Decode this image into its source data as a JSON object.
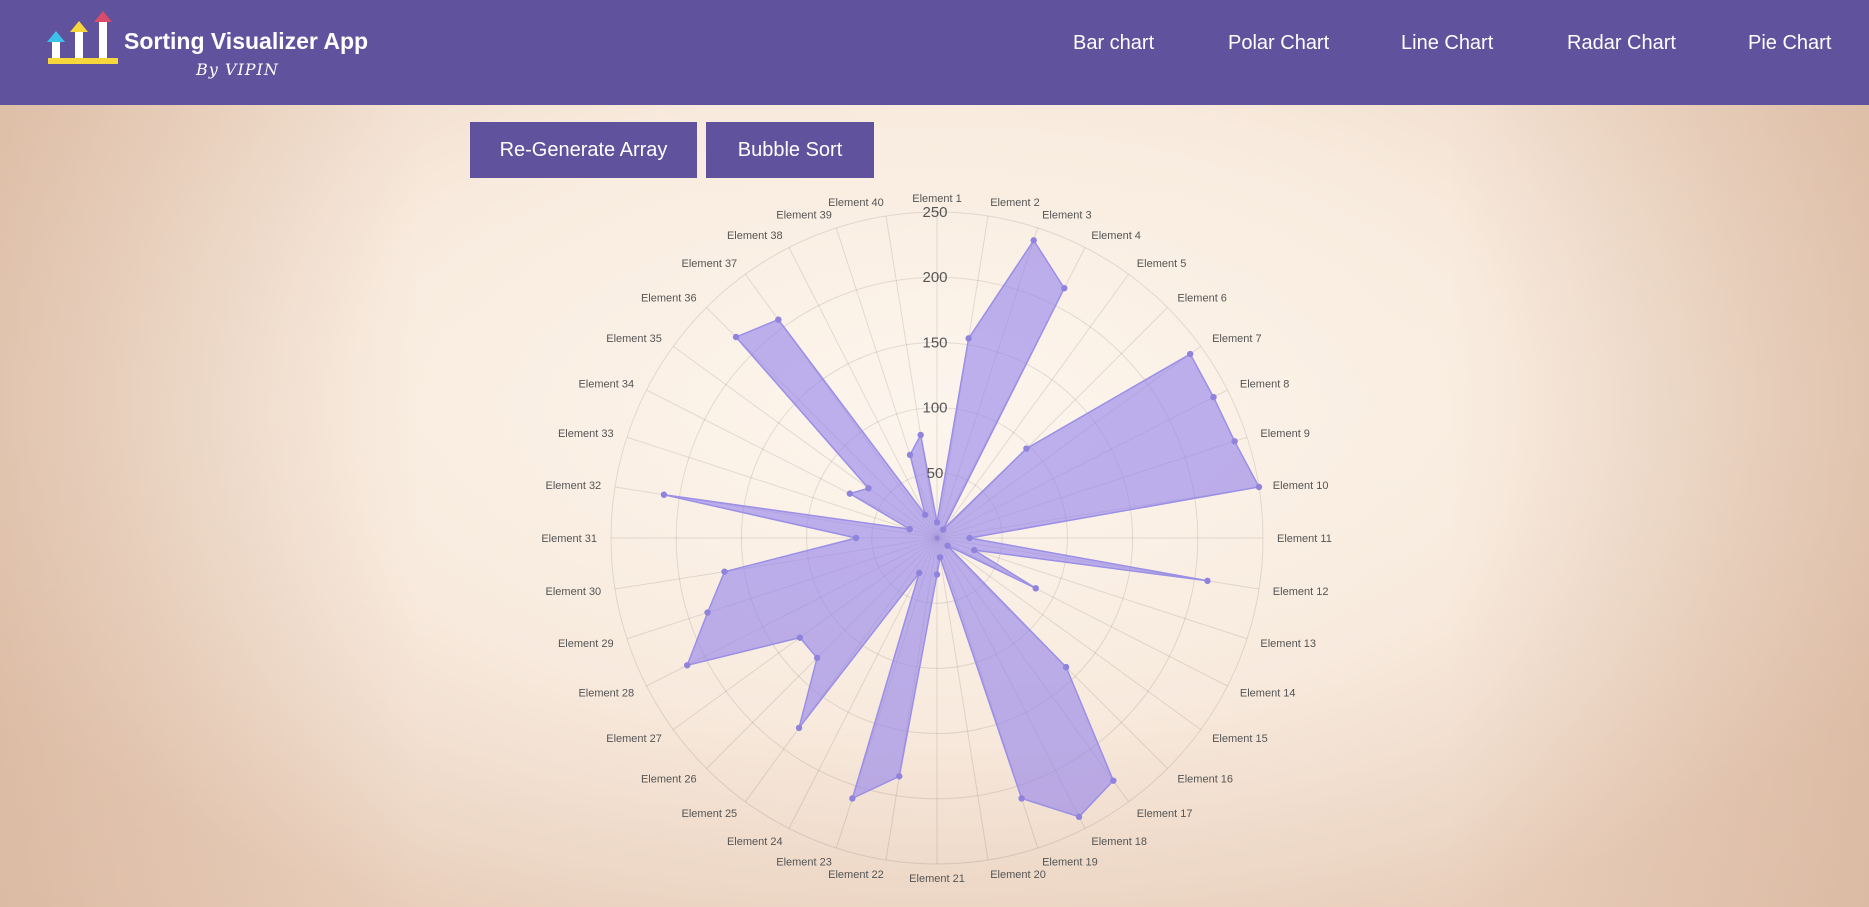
{
  "app": {
    "title": "Sorting Visualizer App",
    "subtitle": "By VIPIN"
  },
  "nav": {
    "items": [
      "Bar chart",
      "Polar Chart",
      "Line Chart",
      "Radar Chart",
      "Pie Chart"
    ]
  },
  "controls": {
    "regenerate_label": "Re-Generate Array",
    "sort_label": "Bubble Sort"
  },
  "colors": {
    "brand": "#61529d",
    "series_fill": "rgba(148,132,236,0.62)",
    "series_stroke": "#9b8fe6",
    "point": "#8f83dc"
  },
  "chart_data": {
    "type": "radar",
    "categories": [
      "Element 1",
      "Element 2",
      "Element 3",
      "Element 4",
      "Element 5",
      "Element 6",
      "Element 7",
      "Element 8",
      "Element 9",
      "Element 10",
      "Element 11",
      "Element 12",
      "Element 13",
      "Element 14",
      "Element 15",
      "Element 16",
      "Element 17",
      "Element 18",
      "Element 19",
      "Element 20",
      "Element 21",
      "Element 22",
      "Element 23",
      "Element 24",
      "Element 25",
      "Element 26",
      "Element 27",
      "Element 28",
      "Element 29",
      "Element 30",
      "Element 31",
      "Element 32",
      "Element 33",
      "Element 34",
      "Element 35",
      "Element 36",
      "Element 37",
      "Element 38",
      "Element 39",
      "Element 40"
    ],
    "values": [
      12,
      155,
      240,
      215,
      8,
      97,
      240,
      238,
      240,
      250,
      25,
      210,
      30,
      85,
      10,
      140,
      230,
      240,
      210,
      15,
      28,
      185,
      210,
      30,
      180,
      130,
      130,
      215,
      185,
      165,
      62,
      212,
      22,
      75,
      65,
      218,
      207,
      20,
      67,
      80
    ],
    "r_ticks": [
      50,
      100,
      150,
      200,
      250
    ],
    "r_range": [
      0,
      250
    ],
    "grid": true,
    "legend": "none"
  }
}
